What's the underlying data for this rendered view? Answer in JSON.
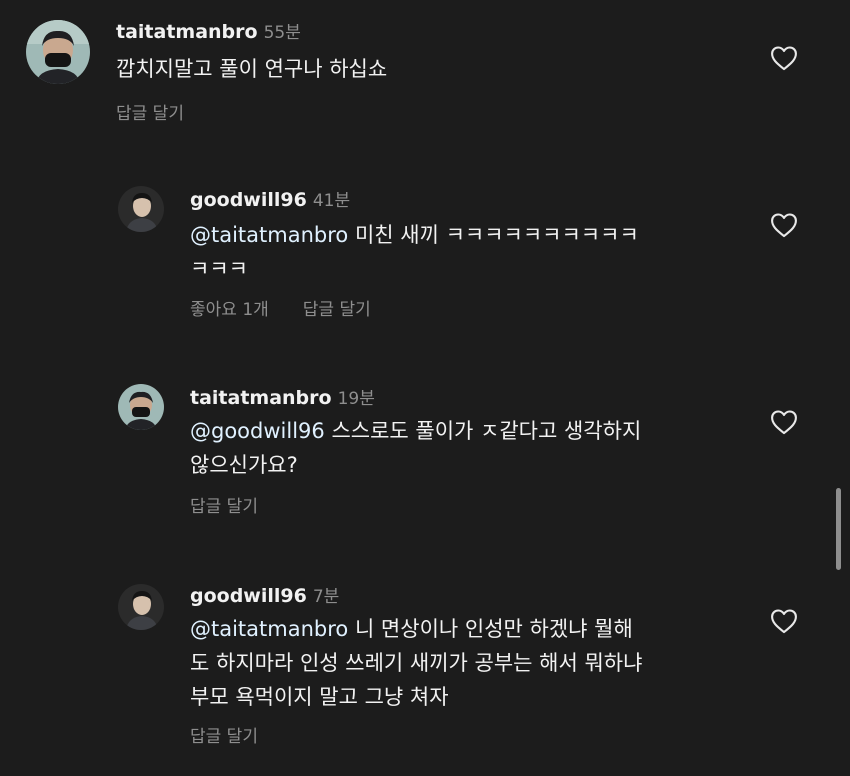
{
  "comments": [
    {
      "username": "taitatmanbro",
      "time": "55분",
      "mention": "",
      "text_lines": [
        "깝치지말고 풀이 연구나 하십쇼"
      ],
      "likes": "",
      "reply": "답글 달기"
    },
    {
      "username": "goodwill96",
      "time": "41분",
      "mention": "@taitatmanbro",
      "text_lines": [
        " 미친 새끼 ㅋㅋㅋㅋㅋㅋㅋㅋㅋㅋ",
        "ㅋㅋㅋ"
      ],
      "likes": "좋아요 1개",
      "reply": "답글 달기"
    },
    {
      "username": "taitatmanbro",
      "time": "19분",
      "mention": "@goodwill96",
      "text_lines": [
        " 스스로도 풀이가 ㅈ같다고 생각하지",
        "않으신가요?"
      ],
      "likes": "",
      "reply": "답글 달기"
    },
    {
      "username": "goodwill96",
      "time": "7분",
      "mention": "@taitatmanbro",
      "text_lines": [
        " 니 면상이나 인성만 하겠냐 뭘해",
        "도 하지마라 인성 쓰레기 새끼가 공부는 해서 뭐하냐",
        "부모 욕먹이지 말고 그냥 쳐자"
      ],
      "likes": "",
      "reply": "답글 달기"
    }
  ],
  "icons": {
    "like": "heart-outline-icon",
    "avatar_taitat": "masked-person-avatar",
    "avatar_goodwill": "person-portrait-avatar"
  },
  "colors": {
    "background": "#1c1c1c",
    "text": "#f2f2f2",
    "secondary": "#8e8e8e",
    "mention": "#e0f1ff"
  }
}
